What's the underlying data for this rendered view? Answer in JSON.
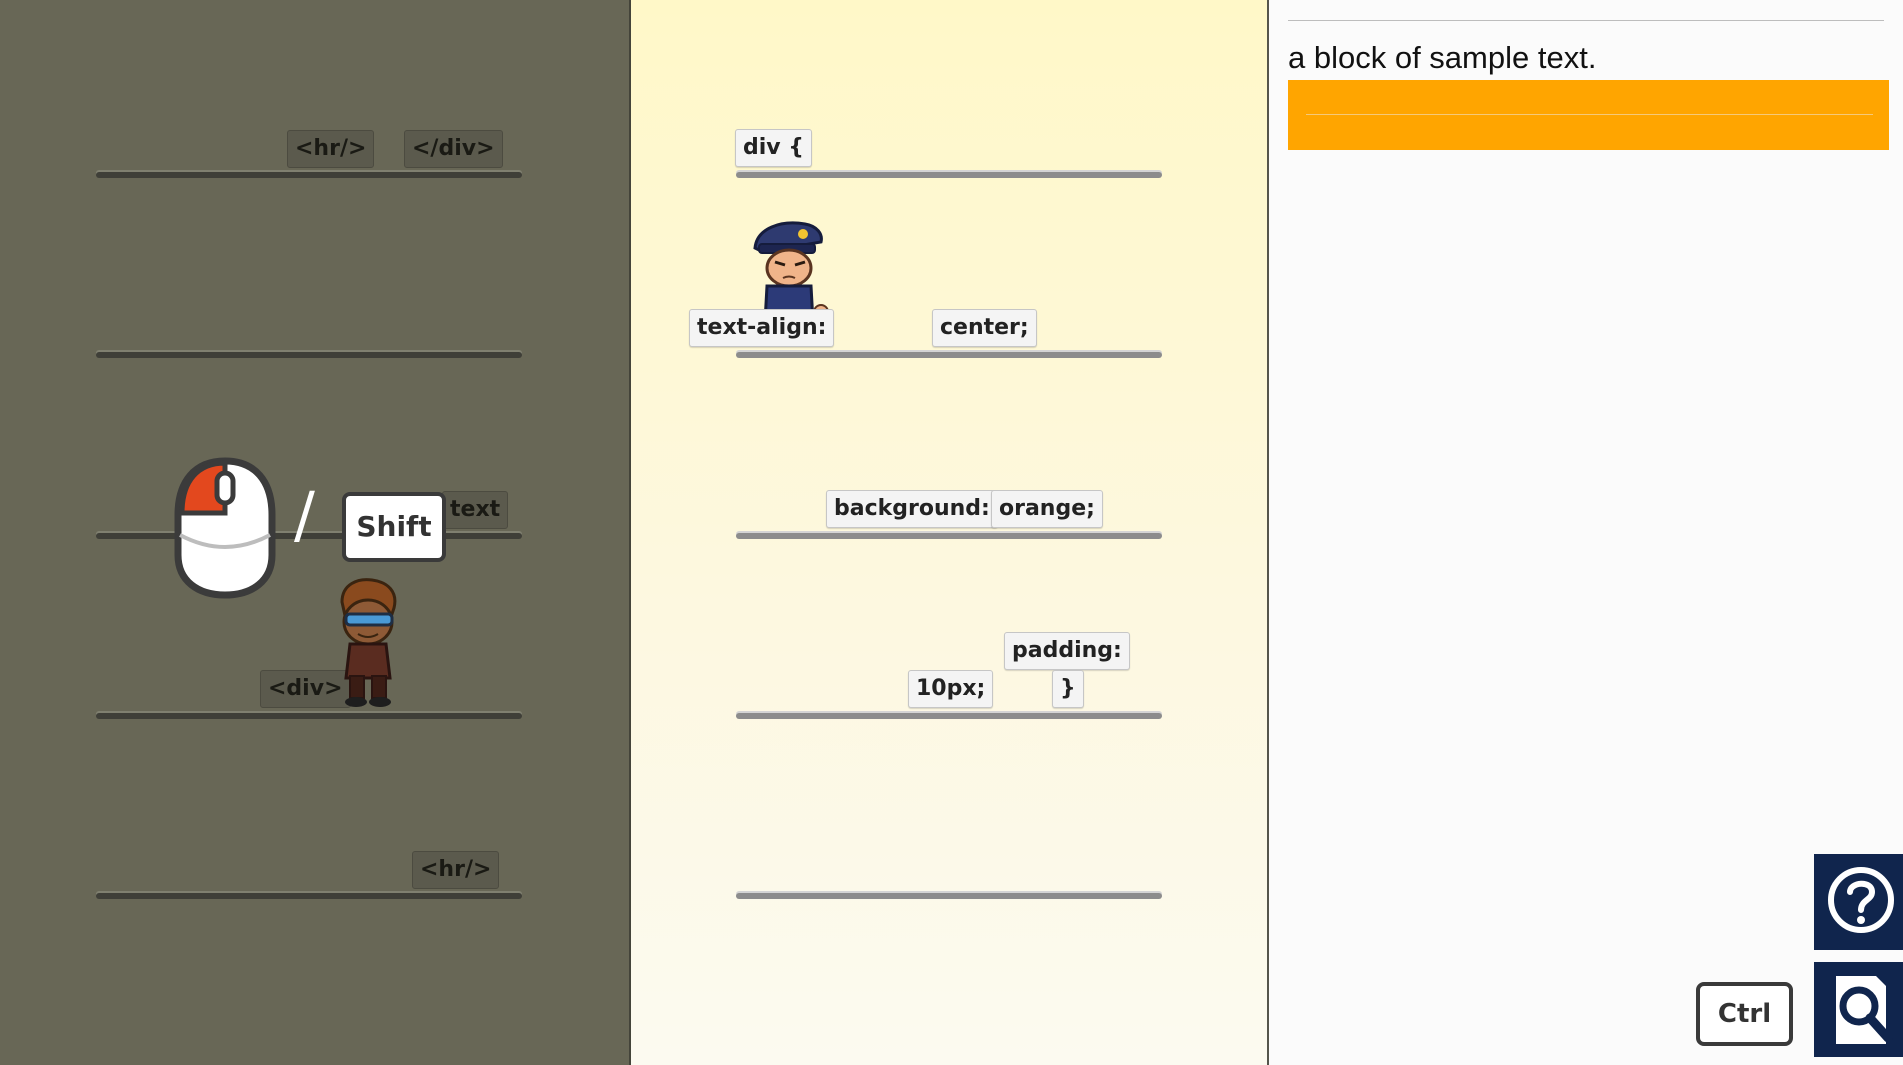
{
  "left_panel": {
    "tokens": {
      "hr_top": "<hr/>",
      "div_close": "</div>",
      "text": "text",
      "div_open": "<div>",
      "hr_bottom": "<hr/>"
    },
    "hint": {
      "slash": "/",
      "shift_label": "Shift"
    }
  },
  "middle_panel": {
    "tokens": {
      "div_selector": "div {",
      "text_align_prop": "text-align:",
      "center_value": "center;",
      "background_prop": "background:",
      "orange_value": "orange;",
      "padding_prop": "padding:",
      "padding_value": "10px;",
      "close_brace": "}"
    }
  },
  "preview_panel": {
    "sample_text": "a block of sample text.",
    "box_color": "#ffa500"
  },
  "controls": {
    "ctrl_label": "Ctrl",
    "help_icon": "question-circle-icon",
    "zoom_icon": "magnifier-page-icon"
  },
  "colors": {
    "left_bg": "#686756",
    "preview_orange": "#ffa500",
    "hud_dark": "#10254d"
  }
}
